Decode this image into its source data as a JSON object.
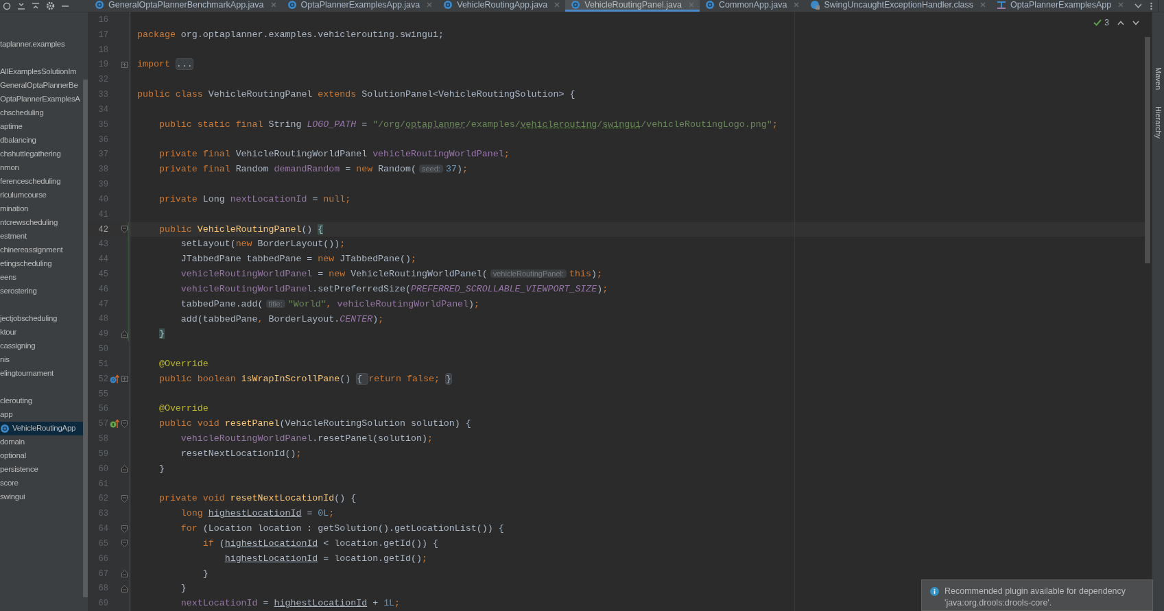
{
  "tabs": [
    {
      "label": "GeneralOptaPlannerBenchmarkApp.java",
      "kind": "class",
      "selected": false
    },
    {
      "label": "OptaPlannerExamplesApp.java",
      "kind": "class",
      "selected": false
    },
    {
      "label": "VehicleRoutingApp.java",
      "kind": "class",
      "selected": false
    },
    {
      "label": "VehicleRoutingPanel.java",
      "kind": "class",
      "selected": true
    },
    {
      "label": "CommonApp.java",
      "kind": "class",
      "selected": false
    },
    {
      "label": "SwingUncaughtExceptionHandler.class",
      "kind": "compiled",
      "selected": false
    },
    {
      "label": "OptaPlannerExamplesApp",
      "kind": "config",
      "selected": false
    }
  ],
  "project_tree": [
    {
      "label": "taplanner.examples",
      "gap_before": false,
      "selected": false
    },
    {
      "label": "AllExamplesSolutionIm",
      "gap_before": true,
      "selected": false
    },
    {
      "label": "GeneralOptaPlannerBe",
      "gap_before": false,
      "selected": false
    },
    {
      "label": "OptaPlannerExamplesA",
      "gap_before": false,
      "selected": false
    },
    {
      "label": "chscheduling",
      "gap_before": false,
      "selected": false
    },
    {
      "label": "aptime",
      "gap_before": false,
      "selected": false
    },
    {
      "label": "dbalancing",
      "gap_before": false,
      "selected": false
    },
    {
      "label": "chshuttlegathering",
      "gap_before": false,
      "selected": false
    },
    {
      "label": "nmon",
      "gap_before": false,
      "selected": false
    },
    {
      "label": "ferencescheduling",
      "gap_before": false,
      "selected": false
    },
    {
      "label": "riculumcourse",
      "gap_before": false,
      "selected": false
    },
    {
      "label": "mination",
      "gap_before": false,
      "selected": false
    },
    {
      "label": "ntcrewscheduling",
      "gap_before": false,
      "selected": false
    },
    {
      "label": "estment",
      "gap_before": false,
      "selected": false
    },
    {
      "label": "chinereassignment",
      "gap_before": false,
      "selected": false
    },
    {
      "label": "etingscheduling",
      "gap_before": false,
      "selected": false
    },
    {
      "label": "eens",
      "gap_before": false,
      "selected": false
    },
    {
      "label": "serostering",
      "gap_before": false,
      "selected": false
    },
    {
      "label": "jectjobscheduling",
      "gap_before": true,
      "selected": false
    },
    {
      "label": "ktour",
      "gap_before": false,
      "selected": false
    },
    {
      "label": "cassigning",
      "gap_before": false,
      "selected": false
    },
    {
      "label": "nis",
      "gap_before": false,
      "selected": false
    },
    {
      "label": "elingtournament",
      "gap_before": false,
      "selected": false
    },
    {
      "label": "clerouting",
      "gap_before": true,
      "selected": false
    },
    {
      "label": "app",
      "gap_before": false,
      "selected": false
    },
    {
      "label": "VehicleRoutingApp",
      "gap_before": false,
      "selected": true
    },
    {
      "label": "domain",
      "gap_before": false,
      "selected": false
    },
    {
      "label": "optional",
      "gap_before": false,
      "selected": false
    },
    {
      "label": "persistence",
      "gap_before": false,
      "selected": false
    },
    {
      "label": "score",
      "gap_before": false,
      "selected": false
    },
    {
      "label": "swingui",
      "gap_before": false,
      "selected": false
    }
  ],
  "inspections": {
    "count": "3"
  },
  "side_tools": [
    "Maven",
    "Hierarchy"
  ],
  "code_lines": [
    {
      "number": "16",
      "current": false,
      "changed": false
    },
    {
      "number": "17",
      "current": false,
      "changed": false,
      "tokens": [
        {
          "kind": "kw",
          "text": "package "
        },
        {
          "kind": "plain",
          "text": "org.optaplanner.examples.vehiclerouting.swingui;"
        }
      ]
    },
    {
      "number": "18",
      "current": false,
      "changed": false
    },
    {
      "number": "19",
      "current": false,
      "changed": false,
      "fold": {
        "kind": "collapsed"
      },
      "tokens": [
        {
          "kind": "kw",
          "text": "import "
        },
        {
          "kind": "folded",
          "text": "..."
        }
      ]
    },
    {
      "number": "32",
      "current": false,
      "changed": false
    },
    {
      "number": "33",
      "current": false,
      "changed": false,
      "tokens": [
        {
          "kind": "kw",
          "text": "public class "
        },
        {
          "kind": "plain",
          "text": "VehicleRoutingPanel "
        },
        {
          "kind": "kw",
          "text": "extends "
        },
        {
          "kind": "plain",
          "text": "SolutionPanel<VehicleRoutingSolution> {"
        }
      ]
    },
    {
      "number": "34",
      "current": false,
      "changed": false
    },
    {
      "number": "35",
      "current": false,
      "changed": false,
      "tokens": [
        {
          "kind": "kw",
          "text": "    public static final "
        },
        {
          "kind": "plain",
          "text": "String "
        },
        {
          "kind": "static",
          "text": "LOGO_PATH"
        },
        {
          "kind": "plain",
          "text": " = "
        },
        {
          "kind": "str",
          "text": "\"/org/"
        },
        {
          "kind": "typo",
          "text": "optaplanner"
        },
        {
          "kind": "str",
          "text": "/examples/"
        },
        {
          "kind": "typo",
          "text": "vehiclerouting"
        },
        {
          "kind": "str",
          "text": "/"
        },
        {
          "kind": "typo",
          "text": "swingui"
        },
        {
          "kind": "str",
          "text": "/vehicleRoutingLogo.png\""
        },
        {
          "kind": "kw",
          "text": ";"
        }
      ]
    },
    {
      "number": "36",
      "current": false,
      "changed": false
    },
    {
      "number": "37",
      "current": false,
      "changed": false,
      "tokens": [
        {
          "kind": "kw",
          "text": "    private final "
        },
        {
          "kind": "plain",
          "text": "VehicleRoutingWorldPanel "
        },
        {
          "kind": "field",
          "text": "vehicleRoutingWorldPanel"
        },
        {
          "kind": "kw",
          "text": ";"
        }
      ]
    },
    {
      "number": "38",
      "current": false,
      "changed": false,
      "tokens": [
        {
          "kind": "kw",
          "text": "    private final "
        },
        {
          "kind": "plain",
          "text": "Random "
        },
        {
          "kind": "field",
          "text": "demandRandom"
        },
        {
          "kind": "plain",
          "text": " = "
        },
        {
          "kind": "kw",
          "text": "new "
        },
        {
          "kind": "plain",
          "text": "Random("
        },
        {
          "kind": "hint",
          "text": "seed:"
        },
        {
          "kind": "num",
          "text": "37"
        },
        {
          "kind": "plain",
          "text": ")"
        },
        {
          "kind": "kw",
          "text": ";"
        }
      ]
    },
    {
      "number": "39",
      "current": false,
      "changed": false
    },
    {
      "number": "40",
      "current": false,
      "changed": false,
      "tokens": [
        {
          "kind": "kw",
          "text": "    private "
        },
        {
          "kind": "plain",
          "text": "Long "
        },
        {
          "kind": "field",
          "text": "nextLocationId"
        },
        {
          "kind": "plain",
          "text": " = "
        },
        {
          "kind": "kw",
          "text": "null;"
        }
      ]
    },
    {
      "number": "41",
      "current": false,
      "changed": false
    },
    {
      "number": "42",
      "current": true,
      "changed": true,
      "fold": {
        "kind": "start"
      },
      "tokens": [
        {
          "kind": "kw",
          "text": "    public "
        },
        {
          "kind": "decl",
          "text": "VehicleRoutingPanel"
        },
        {
          "kind": "plain",
          "text": "() "
        },
        {
          "kind": "match",
          "text": "{"
        }
      ]
    },
    {
      "number": "43",
      "current": false,
      "changed": true,
      "tokens": [
        {
          "kind": "plain",
          "text": "        setLayout("
        },
        {
          "kind": "kw",
          "text": "new "
        },
        {
          "kind": "plain",
          "text": "BorderLayout())"
        },
        {
          "kind": "kw",
          "text": ";"
        }
      ]
    },
    {
      "number": "44",
      "current": false,
      "changed": true,
      "tokens": [
        {
          "kind": "plain",
          "text": "        JTabbedPane tabbedPane = "
        },
        {
          "kind": "kw",
          "text": "new "
        },
        {
          "kind": "plain",
          "text": "JTabbedPane()"
        },
        {
          "kind": "kw",
          "text": ";"
        }
      ]
    },
    {
      "number": "45",
      "current": false,
      "changed": true,
      "tokens": [
        {
          "kind": "field",
          "text": "        vehicleRoutingWorldPanel"
        },
        {
          "kind": "plain",
          "text": " = "
        },
        {
          "kind": "kw",
          "text": "new "
        },
        {
          "kind": "plain",
          "text": "VehicleRoutingWorldPanel("
        },
        {
          "kind": "hint",
          "text": "vehicleRoutingPanel:"
        },
        {
          "kind": "kw",
          "text": "this"
        },
        {
          "kind": "plain",
          "text": ")"
        },
        {
          "kind": "kw",
          "text": ";"
        }
      ]
    },
    {
      "number": "46",
      "current": false,
      "changed": true,
      "tokens": [
        {
          "kind": "field",
          "text": "        vehicleRoutingWorldPanel"
        },
        {
          "kind": "plain",
          "text": ".setPreferredSize("
        },
        {
          "kind": "static",
          "text": "PREFERRED_SCROLLABLE_VIEWPORT_SIZE"
        },
        {
          "kind": "plain",
          "text": ")"
        },
        {
          "kind": "kw",
          "text": ";"
        }
      ]
    },
    {
      "number": "47",
      "current": false,
      "changed": true,
      "tokens": [
        {
          "kind": "plain",
          "text": "        tabbedPane.add("
        },
        {
          "kind": "hint",
          "text": "title:"
        },
        {
          "kind": "str",
          "text": "\"World\""
        },
        {
          "kind": "kw",
          "text": ", "
        },
        {
          "kind": "field",
          "text": "vehicleRoutingWorldPanel"
        },
        {
          "kind": "plain",
          "text": ")"
        },
        {
          "kind": "kw",
          "text": ";"
        }
      ]
    },
    {
      "number": "48",
      "current": false,
      "changed": true,
      "tokens": [
        {
          "kind": "plain",
          "text": "        add(tabbedPane"
        },
        {
          "kind": "kw",
          "text": ", "
        },
        {
          "kind": "plain",
          "text": "BorderLayout."
        },
        {
          "kind": "static",
          "text": "CENTER"
        },
        {
          "kind": "plain",
          "text": ")"
        },
        {
          "kind": "kw",
          "text": ";"
        }
      ]
    },
    {
      "number": "49",
      "current": false,
      "changed": true,
      "fold": {
        "kind": "end"
      },
      "tokens": [
        {
          "kind": "match",
          "text": "    }"
        }
      ]
    },
    {
      "number": "50",
      "current": false,
      "changed": false
    },
    {
      "number": "51",
      "current": false,
      "changed": false,
      "tokens": [
        {
          "kind": "ann",
          "text": "    @Override"
        }
      ]
    },
    {
      "number": "52",
      "current": false,
      "changed": false,
      "fold": {
        "kind": "collapsed"
      },
      "gutter": {
        "kind": "overriding"
      },
      "tokens": [
        {
          "kind": "kw",
          "text": "    public boolean "
        },
        {
          "kind": "decl",
          "text": "isWrapInScrollPane"
        },
        {
          "kind": "plain",
          "text": "() "
        },
        {
          "kind": "folded",
          "text": "{ "
        },
        {
          "kind": "kw",
          "text": "return false; "
        },
        {
          "kind": "folded",
          "text": "}"
        }
      ]
    },
    {
      "number": "55",
      "current": false,
      "changed": false
    },
    {
      "number": "56",
      "current": false,
      "changed": false,
      "tokens": [
        {
          "kind": "ann",
          "text": "    @Override"
        }
      ]
    },
    {
      "number": "57",
      "current": false,
      "changed": false,
      "fold": {
        "kind": "start"
      },
      "gutter": {
        "kind": "implementing"
      },
      "tokens": [
        {
          "kind": "kw",
          "text": "    public void "
        },
        {
          "kind": "decl",
          "text": "resetPanel"
        },
        {
          "kind": "plain",
          "text": "(VehicleRoutingSolution solution) {"
        }
      ]
    },
    {
      "number": "58",
      "current": false,
      "changed": false,
      "tokens": [
        {
          "kind": "field",
          "text": "        vehicleRoutingWorldPanel"
        },
        {
          "kind": "plain",
          "text": ".resetPanel(solution)"
        },
        {
          "kind": "kw",
          "text": ";"
        }
      ]
    },
    {
      "number": "59",
      "current": false,
      "changed": false,
      "tokens": [
        {
          "kind": "plain",
          "text": "        resetNextLocationId()"
        },
        {
          "kind": "kw",
          "text": ";"
        }
      ]
    },
    {
      "number": "60",
      "current": false,
      "changed": false,
      "fold": {
        "kind": "end"
      },
      "tokens": [
        {
          "kind": "plain",
          "text": "    }"
        }
      ]
    },
    {
      "number": "61",
      "current": false,
      "changed": false
    },
    {
      "number": "62",
      "current": false,
      "changed": false,
      "fold": {
        "kind": "start"
      },
      "tokens": [
        {
          "kind": "kw",
          "text": "    private void "
        },
        {
          "kind": "decl",
          "text": "resetNextLocationId"
        },
        {
          "kind": "plain",
          "text": "() {"
        }
      ]
    },
    {
      "number": "63",
      "current": false,
      "changed": false,
      "tokens": [
        {
          "kind": "kw",
          "text": "        long "
        },
        {
          "kind": "local",
          "text": "highestLocationId"
        },
        {
          "kind": "plain",
          "text": " = "
        },
        {
          "kind": "num",
          "text": "0L"
        },
        {
          "kind": "kw",
          "text": ";"
        }
      ]
    },
    {
      "number": "64",
      "current": false,
      "changed": false,
      "fold": {
        "kind": "start"
      },
      "tokens": [
        {
          "kind": "kw",
          "text": "        for "
        },
        {
          "kind": "plain",
          "text": "(Location location : getSolution().getLocationList()) {"
        }
      ]
    },
    {
      "number": "65",
      "current": false,
      "changed": false,
      "fold": {
        "kind": "start"
      },
      "tokens": [
        {
          "kind": "kw",
          "text": "            if "
        },
        {
          "kind": "plain",
          "text": "("
        },
        {
          "kind": "local",
          "text": "highestLocationId"
        },
        {
          "kind": "plain",
          "text": " < location.getId()) {"
        }
      ]
    },
    {
      "number": "66",
      "current": false,
      "changed": false,
      "tokens": [
        {
          "kind": "local",
          "text": "                highestLocationId"
        },
        {
          "kind": "plain",
          "text": " = location.getId()"
        },
        {
          "kind": "kw",
          "text": ";"
        }
      ]
    },
    {
      "number": "67",
      "current": false,
      "changed": false,
      "fold": {
        "kind": "end"
      },
      "tokens": [
        {
          "kind": "plain",
          "text": "            }"
        }
      ]
    },
    {
      "number": "68",
      "current": false,
      "changed": false,
      "fold": {
        "kind": "end"
      },
      "tokens": [
        {
          "kind": "plain",
          "text": "        }"
        }
      ]
    },
    {
      "number": "69",
      "current": false,
      "changed": false,
      "tokens": [
        {
          "kind": "field",
          "text": "        nextLocationId"
        },
        {
          "kind": "plain",
          "text": " = "
        },
        {
          "kind": "local",
          "text": "highestLocationId"
        },
        {
          "kind": "plain",
          "text": " + "
        },
        {
          "kind": "num",
          "text": "1L"
        },
        {
          "kind": "kw",
          "text": ";"
        }
      ]
    }
  ],
  "notification": {
    "text": "Recommended plugin available for dependency 'java:org.drools:drools-core'."
  }
}
